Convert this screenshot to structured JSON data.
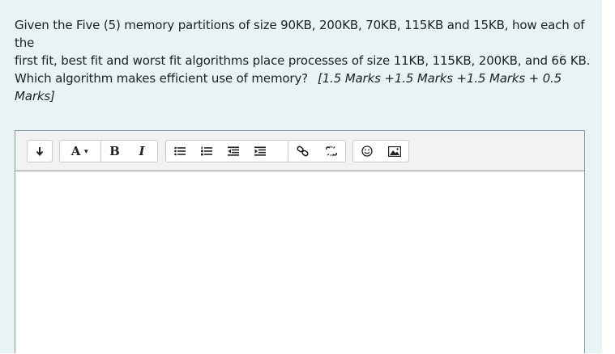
{
  "question": {
    "text_line1": "Given the Five (5) memory partitions of size 90KB, 200KB, 70KB, 115KB and 15KB, how each of the",
    "text_line2": "first fit, best fit and worst fit algorithms place processes of size 11KB, 115KB, 200KB, and 66 KB.",
    "text_line3": "Which algorithm makes efficient use of memory?",
    "marks_line3": "[1.5 Marks +1.5 Marks +1.5 Marks + 0.5",
    "marks_line4": "Marks]"
  },
  "editor": {
    "toolbar": {
      "show_more_icon": "arrow-down-icon",
      "paragraph_label": "A",
      "bold_label": "B",
      "italic_label": "I",
      "groups": [
        "collapse",
        "style",
        "list",
        "links",
        "files"
      ]
    },
    "content": ""
  },
  "colors": {
    "panel_bg": "#e7f3f5",
    "text": "#1d2125",
    "toolbar_bg": "#f2f2f2",
    "border": "#8f959e"
  }
}
